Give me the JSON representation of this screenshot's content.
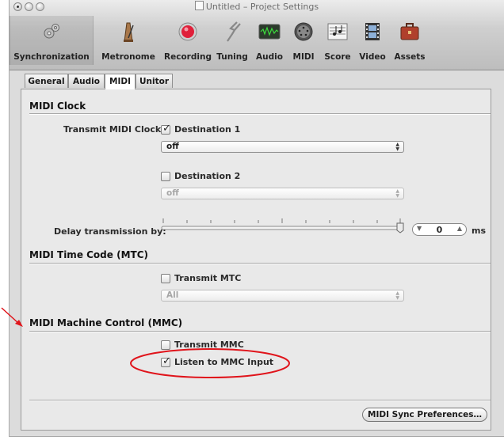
{
  "window": {
    "title": "Untitled – Project Settings"
  },
  "toolbar": {
    "items": [
      {
        "label": "Synchronization",
        "icon": "gears-icon"
      },
      {
        "label": "Metronome",
        "icon": "metronome-icon"
      },
      {
        "label": "Recording",
        "icon": "record-icon"
      },
      {
        "label": "Tuning",
        "icon": "tuning-fork-icon"
      },
      {
        "label": "Audio",
        "icon": "audio-waveform-icon"
      },
      {
        "label": "MIDI",
        "icon": "midi-connector-icon"
      },
      {
        "label": "Score",
        "icon": "score-notes-icon"
      },
      {
        "label": "Video",
        "icon": "film-icon"
      },
      {
        "label": "Assets",
        "icon": "briefcase-icon"
      }
    ],
    "selected": "Synchronization"
  },
  "tabs": [
    {
      "label": "General"
    },
    {
      "label": "Audio"
    },
    {
      "label": "MIDI"
    },
    {
      "label": "Unitor"
    }
  ],
  "active_tab": "MIDI",
  "midi_clock": {
    "heading": "MIDI Clock",
    "transmit_label": "Transmit MIDI Clock:",
    "destination1": {
      "label": "Destination 1",
      "checked": true,
      "value": "off"
    },
    "destination2": {
      "label": "Destination 2",
      "checked": false,
      "value": "off"
    },
    "delay_label": "Delay transmission by:",
    "delay_value": "0",
    "delay_unit": "ms"
  },
  "mtc": {
    "heading": "MIDI Time Code (MTC)",
    "transmit_label": "Transmit MTC",
    "checked": false,
    "value": "All"
  },
  "mmc": {
    "heading": "MIDI Machine Control (MMC)",
    "transmit_label": "Transmit MMC",
    "transmit_checked": false,
    "listen_label": "Listen to MMC Input",
    "listen_checked": true
  },
  "sync_prefs_button": "MIDI Sync Preferences…",
  "annotation": {
    "color": "#e0141b"
  },
  "colors": {
    "record_red": "#e0203a",
    "window_bg": "#dcdcdc"
  }
}
